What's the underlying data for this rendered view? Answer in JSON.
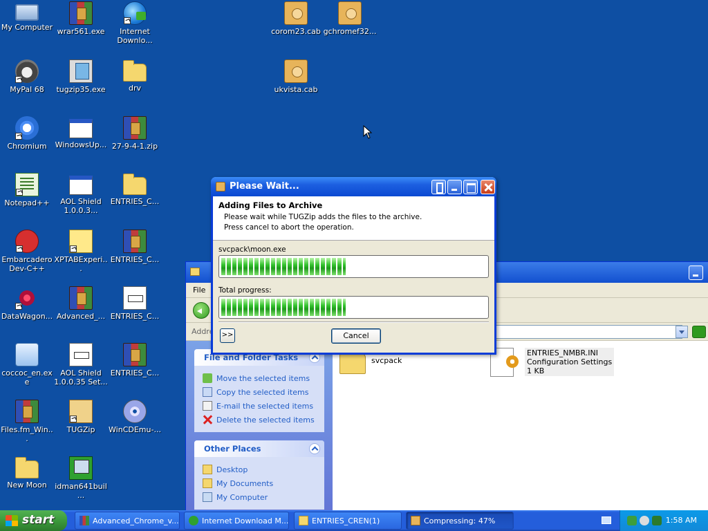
{
  "desktop": {
    "icons": [
      {
        "label": "My Computer"
      },
      {
        "label": "wrar561.exe"
      },
      {
        "label": "Internet Downlo..."
      },
      {
        "label": "corom23.cab"
      },
      {
        "label": "gchromef32..."
      },
      {
        "label": "MyPal 68"
      },
      {
        "label": "tugzip35.exe"
      },
      {
        "label": "drv"
      },
      {
        "label": "ukvista.cab"
      },
      {
        "label": "Chromium"
      },
      {
        "label": "WindowsUp..."
      },
      {
        "label": "27-9-4-1.zip"
      },
      {
        "label": "Notepad++"
      },
      {
        "label": "AOL Shield 1.0.0.3..."
      },
      {
        "label": "ENTRIES_C..."
      },
      {
        "label": "Embarcadero Dev-C++"
      },
      {
        "label": "XPTABExperi..."
      },
      {
        "label": "ENTRIES_C..."
      },
      {
        "label": "DataWagon..."
      },
      {
        "label": "Advanced_..."
      },
      {
        "label": "ENTRIES_C..."
      },
      {
        "label": "coccoc_en.exe"
      },
      {
        "label": "AOL Shield 1.0.0.35 Set..."
      },
      {
        "label": "ENTRIES_C..."
      },
      {
        "label": "Files.fm_Win..."
      },
      {
        "label": "TUGZip"
      },
      {
        "label": "WinCDEmu-..."
      },
      {
        "label": "New Moon"
      },
      {
        "label": "idman641buil..."
      }
    ]
  },
  "explorer": {
    "menu_first": "File",
    "address_label": "Addre",
    "tasks": {
      "title": "File and Folder Tasks",
      "items": [
        {
          "label": "Move the selected items"
        },
        {
          "label": "Copy the selected items"
        },
        {
          "label": "E-mail the selected items"
        },
        {
          "label": "Delete the selected items"
        }
      ]
    },
    "places": {
      "title": "Other Places",
      "items": [
        {
          "label": "Desktop"
        },
        {
          "label": "My Documents"
        },
        {
          "label": "My Computer"
        }
      ]
    },
    "files": [
      {
        "name": "svcpack"
      },
      {
        "name": "ENTRIES_NMBR.INI",
        "type": "Configuration Settings",
        "size": "1 KB"
      }
    ]
  },
  "dialog": {
    "title": "Please Wait...",
    "heading": "Adding Files to Archive",
    "line1": "Please wait while TUGZip adds the files to the archive.",
    "line2": "Press cancel to abort the operation.",
    "current_file": "svcpack\\moon.exe",
    "current_progress": 0.47,
    "total_label": "Total progress:",
    "total_progress": 0.47,
    "more_label": ">>",
    "cancel_label": "Cancel"
  },
  "taskbar": {
    "start_label": "start",
    "buttons": [
      {
        "label": "Advanced_Chrome_v..."
      },
      {
        "label": "Internet Download M..."
      },
      {
        "label": "ENTRIES_CREN(1)"
      },
      {
        "label": "Compressing: 47%"
      }
    ],
    "clock": "1:58 AM"
  }
}
